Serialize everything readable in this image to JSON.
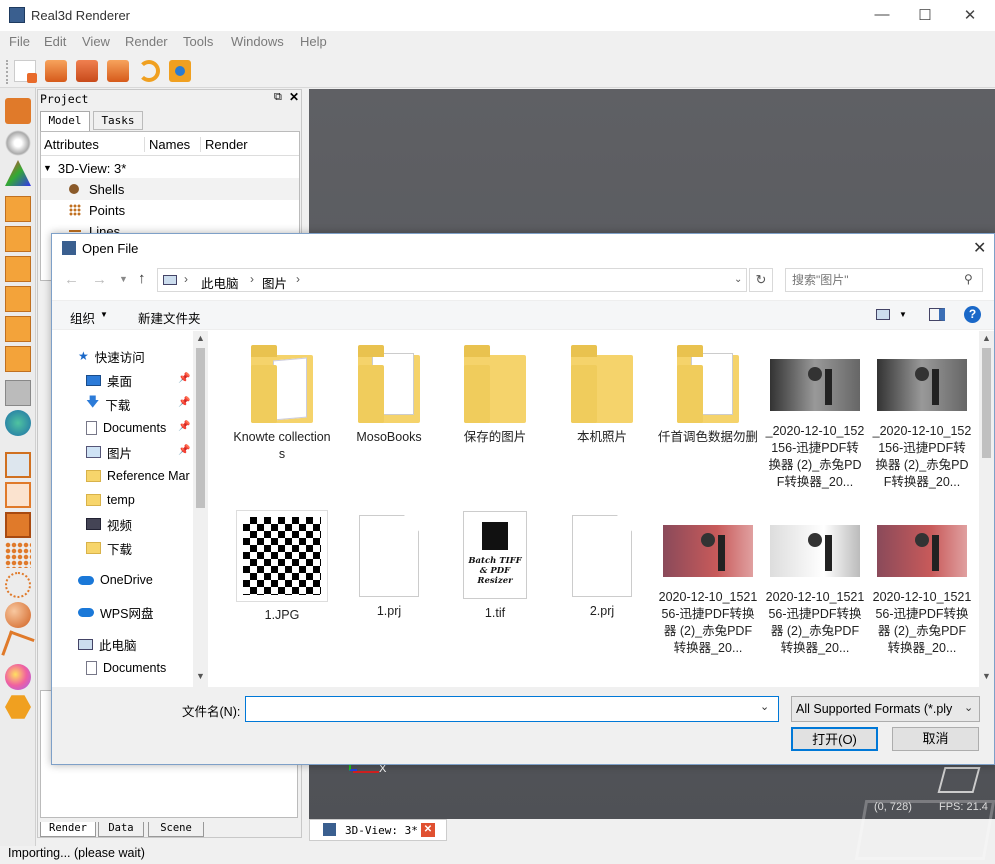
{
  "app": {
    "title": "Real3d Renderer"
  },
  "menu": [
    "File",
    "Edit",
    "View",
    "Render",
    "Tools",
    "Windows",
    "Help"
  ],
  "project": {
    "title": "Project",
    "tabs": [
      "Model",
      "Tasks"
    ],
    "columns": [
      "Attributes",
      "Names",
      "Render"
    ],
    "tree": [
      "3D-View: 3*",
      "Shells",
      "Points",
      "Lines"
    ],
    "bottom_tabs": [
      "Render",
      "Data",
      "Scene"
    ]
  },
  "viewport": {
    "tab_label": "3D-View: 3*",
    "coords": "(0, 728)",
    "fps": "FPS: 21.4",
    "axis_x": "X"
  },
  "status": "Importing... (please wait)",
  "dialog": {
    "title": "Open File",
    "breadcrumb": [
      "此电脑",
      "图片"
    ],
    "search_placeholder": "搜索\"图片\"",
    "organize": "组织",
    "new_folder": "新建文件夹",
    "nav": [
      {
        "label": "快速访问",
        "icon": "star-icon"
      },
      {
        "label": "桌面",
        "icon": "desktop-icon"
      },
      {
        "label": "下载",
        "icon": "download-icon"
      },
      {
        "label": "Documents",
        "icon": "document-icon"
      },
      {
        "label": "图片",
        "icon": "pictures-icon"
      },
      {
        "label": "Reference Mar",
        "icon": "folder-icon"
      },
      {
        "label": "temp",
        "icon": "folder-icon"
      },
      {
        "label": "视频",
        "icon": "video-icon"
      },
      {
        "label": "下载",
        "icon": "folder-icon"
      },
      {
        "label": "OneDrive",
        "icon": "cloud-icon"
      },
      {
        "label": "WPS网盘",
        "icon": "cloud-icon"
      },
      {
        "label": "此电脑",
        "icon": "computer-icon"
      },
      {
        "label": "Documents",
        "icon": "document-icon"
      }
    ],
    "files_row1": [
      {
        "label": "Knowte collections",
        "kind": "folder-docs"
      },
      {
        "label": "MosoBooks",
        "kind": "folder-white"
      },
      {
        "label": "保存的图片",
        "kind": "folder"
      },
      {
        "label": "本机照片",
        "kind": "folder"
      },
      {
        "label": "仟首调色数据勿删",
        "kind": "folder-white"
      },
      {
        "label": "_2020-12-10_152156-迅捷PDF转换器 (2)_赤兔PDF转换器_20...",
        "kind": "photo-gray"
      },
      {
        "label": "_2020-12-10_152156-迅捷PDF转换器 (2)_赤兔PDF转换器_20...",
        "kind": "photo-gray"
      }
    ],
    "files_row2": [
      {
        "label": "1.JPG",
        "kind": "qr"
      },
      {
        "label": "1.prj",
        "kind": "blank"
      },
      {
        "label": "1.tif",
        "kind": "tif"
      },
      {
        "label": "2.prj",
        "kind": "blank"
      },
      {
        "label": "2020-12-10_152156-迅捷PDF转换器 (2)_赤兔PDF转换器_20...",
        "kind": "photo-pink"
      },
      {
        "label": "2020-12-10_152156-迅捷PDF转换器 (2)_赤兔PDF转换器_20...",
        "kind": "photo-white"
      },
      {
        "label": "2020-12-10_152156-迅捷PDF转换器 (2)_赤兔PDF转换器_20...",
        "kind": "photo-pink"
      }
    ],
    "tif_text": "Batch TIFF & PDF Resizer",
    "filename_label": "文件名(N):",
    "filename_value": "",
    "filter": "All Supported Formats (*.ply",
    "open": "打开(O)",
    "cancel": "取消"
  }
}
